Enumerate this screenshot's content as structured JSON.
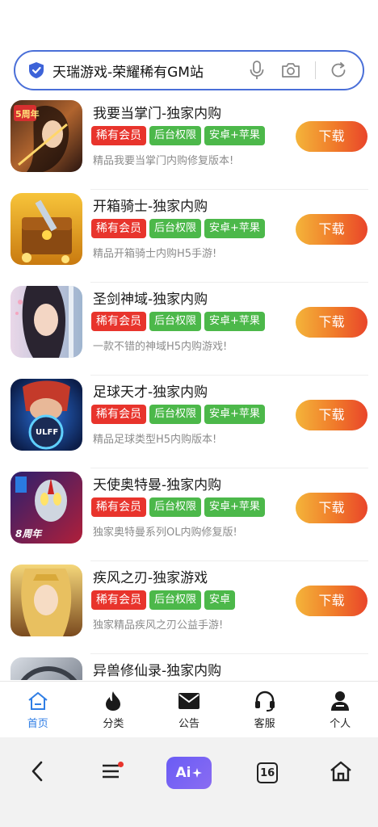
{
  "search": {
    "text": "天瑞游戏-荣耀稀有GM站"
  },
  "apps": [
    {
      "title": "我要当掌门-独家内购",
      "tags": [
        "稀有会员",
        "后台权限",
        "安卓+苹果"
      ],
      "desc": "精品我要当掌门内购修复版本!",
      "button": "下载",
      "icon_badge": "5周年"
    },
    {
      "title": "开箱骑士-独家内购",
      "tags": [
        "稀有会员",
        "后台权限",
        "安卓+苹果"
      ],
      "desc": "精品开箱骑士内购H5手游!",
      "button": "下载"
    },
    {
      "title": "圣剑神域-独家内购",
      "tags": [
        "稀有会员",
        "后台权限",
        "安卓+苹果"
      ],
      "desc": "一款不错的神域H5内购游戏!",
      "button": "下载"
    },
    {
      "title": "足球天才-独家内购",
      "tags": [
        "稀有会员",
        "后台权限",
        "安卓+苹果"
      ],
      "desc": "精品足球类型H5内购版本!",
      "button": "下载",
      "icon_badge": "ULFF"
    },
    {
      "title": "天使奥特曼-独家内购",
      "tags": [
        "稀有会员",
        "后台权限",
        "安卓+苹果"
      ],
      "desc": "独家奥特曼系列OL内购修复版!",
      "button": "下载",
      "icon_badge": "8周年"
    },
    {
      "title": "疾风之刃-独家游戏",
      "tags": [
        "稀有会员",
        "后台权限",
        "安卓"
      ],
      "desc": "独家精品疾风之刃公益手游!",
      "button": "下载"
    },
    {
      "title": "异兽修仙录-独家内购",
      "tags": [],
      "desc": "",
      "button": ""
    }
  ],
  "tabbar": {
    "items": [
      {
        "label": "首页",
        "icon": "home-icon"
      },
      {
        "label": "分类",
        "icon": "fire-icon"
      },
      {
        "label": "公告",
        "icon": "mail-icon"
      },
      {
        "label": "客服",
        "icon": "headset-icon"
      },
      {
        "label": "个人",
        "icon": "person-icon"
      }
    ]
  },
  "sysnav": {
    "ai_label": "Ai",
    "tabs_count": "16"
  },
  "colors": {
    "accent": "#2f7ee5",
    "tag_red": "#e8342c",
    "tag_green": "#4cb84a",
    "button_start": "#f4b43a",
    "button_end": "#e9452a",
    "search_border": "#4a6fd8"
  }
}
